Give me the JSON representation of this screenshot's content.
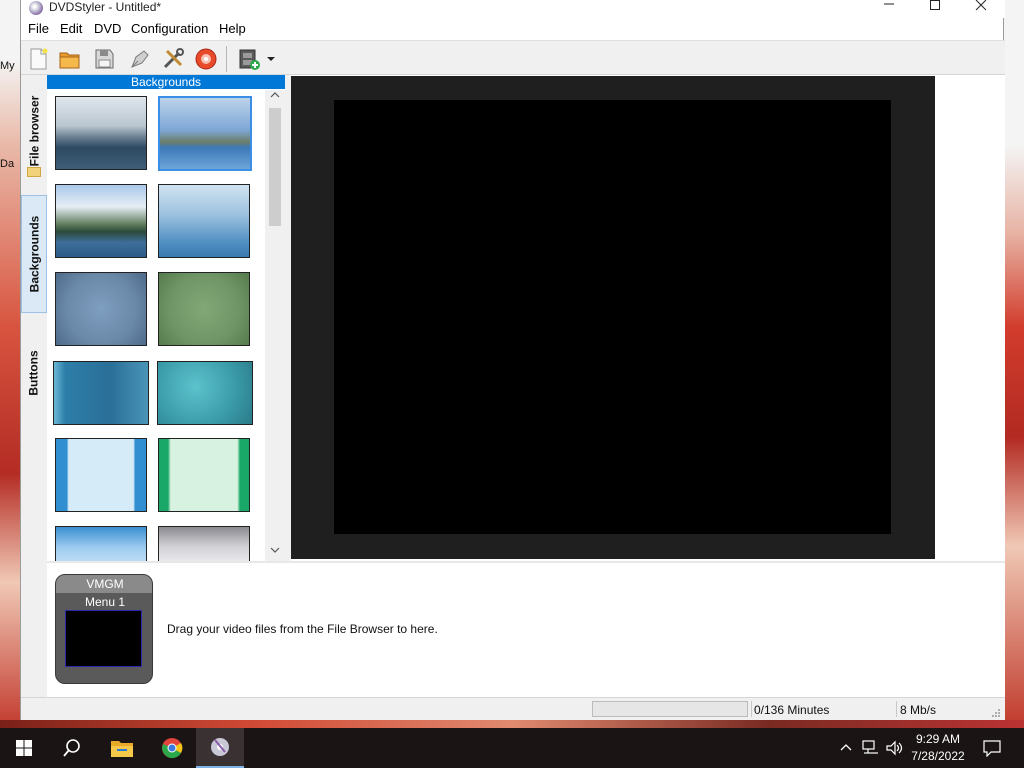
{
  "window": {
    "title": "DVDStyler - Untitled*"
  },
  "desktop": {
    "labels": [
      "My",
      "Da"
    ]
  },
  "menu": [
    "File",
    "Edit",
    "DVD",
    "Configuration",
    "Help"
  ],
  "toolbar": {
    "icons": [
      "new-file-icon",
      "open-folder-icon",
      "save-icon",
      "burn-pen-icon",
      "settings-tools-icon",
      "burn-disc-icon",
      "add-video-icon",
      "dropdown-arrow-icon"
    ]
  },
  "side_tabs": [
    "File browser",
    "Backgrounds",
    "Buttons"
  ],
  "backgrounds_panel": {
    "header": "Backgrounds"
  },
  "titleset": {
    "vmgm_label": "VMGM",
    "menu_label": "Menu 1",
    "drag_hint": "Drag your video files from the File Browser to here."
  },
  "status": {
    "duration": "0/136 Minutes",
    "bitrate": "8 Mb/s"
  },
  "taskbar": {
    "time": "9:29 AM",
    "date": "7/28/2022",
    "apps": [
      "start-icon",
      "search-icon",
      "file-explorer-icon",
      "chrome-icon",
      "dvdstyler-icon"
    ]
  },
  "colors": {
    "accent": "#0078d7",
    "preview_bg": "#1f1f1f",
    "taskbar": "#1a1414"
  }
}
